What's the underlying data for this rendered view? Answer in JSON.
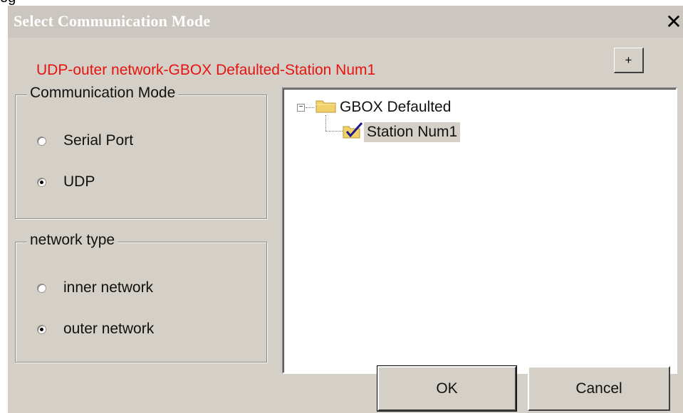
{
  "top_strip_text": "og",
  "window": {
    "title": "Select Communication Mode",
    "close_symbol": "✕"
  },
  "status_text": "UDP-outer network-GBOX Defaulted-Station Num1",
  "plus_button": "+",
  "communication_mode": {
    "legend": "Communication Mode",
    "options": [
      {
        "label": "Serial Port",
        "selected": false
      },
      {
        "label": "UDP",
        "selected": true
      }
    ]
  },
  "network_type": {
    "legend": "network type",
    "options": [
      {
        "label": "inner network",
        "selected": false
      },
      {
        "label": "outer network",
        "selected": true
      }
    ]
  },
  "tree": {
    "expander_symbol": "−",
    "root": {
      "label": "GBOX Defaulted",
      "icon": "folder-icon"
    },
    "child": {
      "label": "Station Num1",
      "icon": "checked-item-icon",
      "selected": true
    }
  },
  "buttons": {
    "ok": "OK",
    "cancel": "Cancel"
  },
  "colors": {
    "dialog_bg": "#d4d0c8",
    "title_bar": "#cbc7c0",
    "status_text": "#e8130f",
    "folder": "#f2d16b"
  }
}
